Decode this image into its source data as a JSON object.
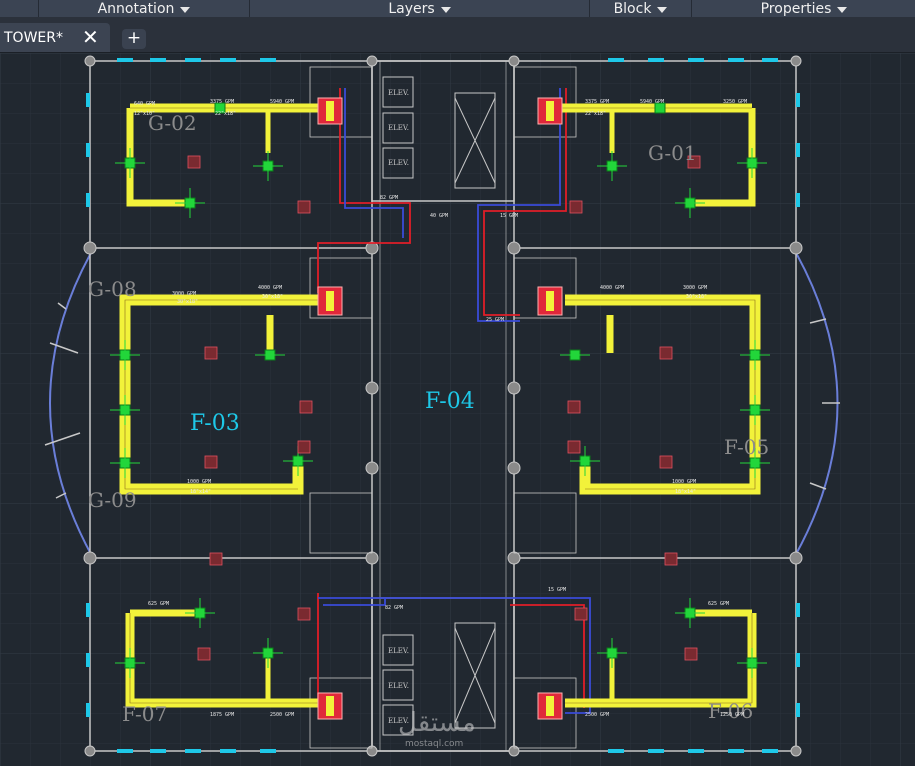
{
  "ribbon": {
    "panels": [
      {
        "label": "Annotation"
      },
      {
        "label": "Layers"
      },
      {
        "label": "Block"
      },
      {
        "label": "Properties"
      }
    ]
  },
  "tabs": {
    "active_label": "TOWER*",
    "close_glyph": "✕",
    "new_tab_glyph": "+"
  },
  "drawing": {
    "zone_labels": [
      "G-02",
      "G-01",
      "G-08",
      "F-03",
      "F-04",
      "F-05",
      "G-09",
      "F-07",
      "F-06"
    ],
    "elevator_label": "ELEV.",
    "duct_labels": [
      "640 GPM",
      "3375 GPM",
      "5940 GPM",
      "2500 GPM",
      "1875 GPM",
      "3250 GPM",
      "12\"x10\"",
      "22\"x18\"",
      "30\"x18\"",
      "18\"x14\"",
      "3000 GPM",
      "4000 GPM",
      "1000 GPM",
      "3000 GPM",
      "2500 GPM",
      "1250 GPM",
      "625 GPM",
      "40 GPM",
      "82 GPM",
      "15 GPM",
      "25 GPM"
    ],
    "watermark": "مستقل",
    "watermark_sub": "mostaql.com",
    "colors": {
      "background": "#212830",
      "grid": "#2a323c",
      "wall": "#c8c8c8",
      "duct": "#f2f23a",
      "diffuser": "#22d63a",
      "unit": "#e0283a",
      "pipe_red": "#e01e28",
      "pipe_blue": "#3a4bd8",
      "window": "#1ec8e8",
      "arc": "#6a7ed8"
    }
  }
}
